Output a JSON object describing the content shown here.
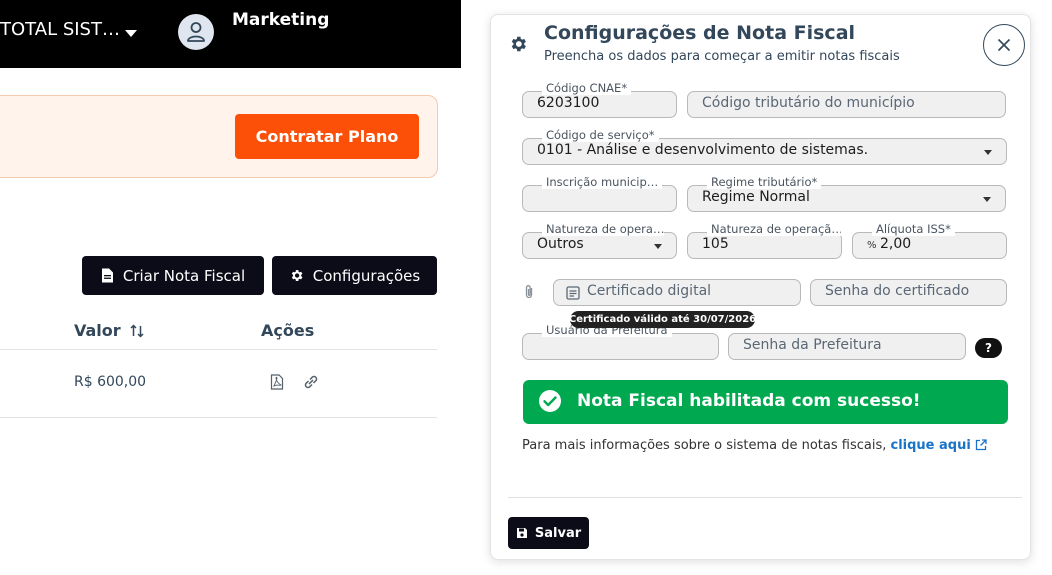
{
  "topbar": {
    "company_name": "TOTAL SIST…",
    "department": "Marketing",
    "caret_icon": "caret-down-icon",
    "avatar_icon": "user-icon"
  },
  "banner": {
    "plan_button_label": "Contratar Plano"
  },
  "actions": {
    "create_invoice_label": "Criar Nota Fiscal",
    "settings_label": "Configurações"
  },
  "table": {
    "columns": [
      "Valor",
      "Ações"
    ],
    "rows": [
      {
        "valor": "R$ 600,00",
        "action_icons": [
          "pdf-icon",
          "link-icon"
        ]
      }
    ]
  },
  "panel": {
    "title": "Configurações de Nota Fiscal",
    "subtitle": "Preencha os dados para começar a emitir notas fiscais",
    "fields": {
      "cnae": {
        "label": "Código CNAE*",
        "value": "6203100"
      },
      "codigo_tributario": {
        "placeholder": "Código tributário do município"
      },
      "codigo_servico": {
        "label": "Código de serviço*",
        "value": "0101 - Análise e desenvolvimento de sistemas."
      },
      "inscricao_municipal": {
        "label": "Inscrição municip…"
      },
      "regime_tributario": {
        "label": "Regime tributário*",
        "value": "Regime Normal"
      },
      "natureza_operacao_1": {
        "label": "Natureza de opera…",
        "value": "Outros"
      },
      "natureza_operacao_2": {
        "label": "Natureza de operaçã…",
        "value": "105"
      },
      "aliquota_iss": {
        "label": "Alíquota ISS*",
        "prefix": "%",
        "value": "2,00"
      },
      "certificado": {
        "placeholder": "Certificado digital"
      },
      "senha_certificado": {
        "placeholder": "Senha do certificado"
      },
      "usuario_prefeitura": {
        "label": "Usuário da Prefeitura"
      },
      "senha_prefeitura": {
        "placeholder": "Senha da Prefeitura"
      }
    },
    "certificate_tooltip": "Certificado válido até 30/07/2026",
    "help_label": "?",
    "success_message": "Nota Fiscal habilitada com sucesso!",
    "info_text": "Para mais informações sobre o sistema de notas fiscais,",
    "info_link": "clique aqui",
    "save_label": "Salvar",
    "colors": {
      "success": "#00a94f",
      "primary_orange": "#fc4f08",
      "dark_button": "#0c0c18",
      "link": "#1a73c9"
    }
  }
}
